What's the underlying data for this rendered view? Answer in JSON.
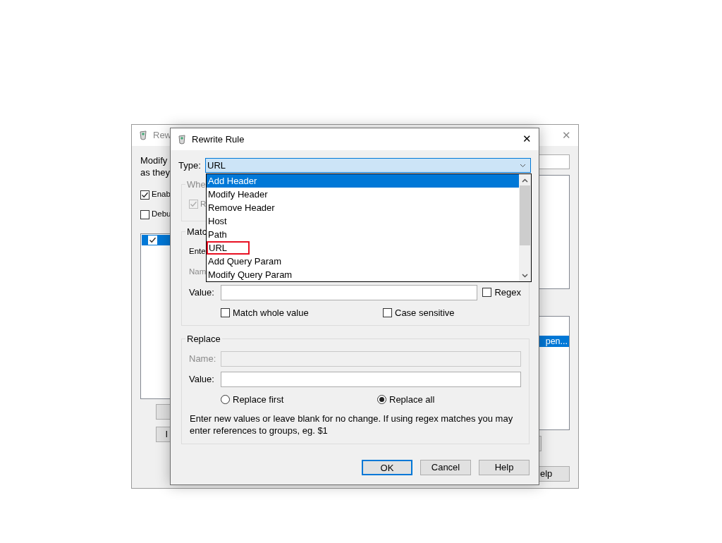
{
  "back_window": {
    "title": "Rew",
    "close_glyph": "✕",
    "description_lines": [
      "Modify",
      "as they"
    ],
    "options": [
      {
        "label": "Enab",
        "checked": true
      },
      {
        "label": "Debu",
        "checked": false
      }
    ],
    "rules_list": [
      {
        "checked": true,
        "selected": true
      }
    ],
    "left_button": "I",
    "right_list": [
      {
        "text": "pen...",
        "selected": true
      }
    ],
    "partial_button": "elp"
  },
  "dialog": {
    "title": "Rewrite Rule",
    "close_glyph": "✕",
    "type_label": "Type:",
    "type_value": "URL",
    "dropdown": [
      {
        "label": "Add Header",
        "selected": true,
        "highlighted": false
      },
      {
        "label": "Modify Header",
        "selected": false,
        "highlighted": false
      },
      {
        "label": "Remove Header",
        "selected": false,
        "highlighted": false
      },
      {
        "label": "Host",
        "selected": false,
        "highlighted": false
      },
      {
        "label": "Path",
        "selected": false,
        "highlighted": false
      },
      {
        "label": "URL",
        "selected": false,
        "highlighted": true
      },
      {
        "label": "Add Query Param",
        "selected": false,
        "highlighted": false
      },
      {
        "label": "Modify Query Param",
        "selected": false,
        "highlighted": false
      }
    ],
    "when_group": {
      "legend": "Whe",
      "checkbox": {
        "label": "R",
        "checked": true,
        "disabled": true
      }
    },
    "match_group": {
      "legend": "Matc",
      "hint": "Ente",
      "name_label": "Nam",
      "value_label": "Value:",
      "regex": {
        "label": "Regex",
        "checked": false
      },
      "match_whole": {
        "label": "Match whole value",
        "checked": false
      },
      "case_sensitive": {
        "label": "Case sensitive",
        "checked": false
      }
    },
    "replace_group": {
      "legend": "Replace",
      "name_label": "Name:",
      "name_disabled": true,
      "value_label": "Value:",
      "modes": [
        {
          "label": "Replace first",
          "selected": false
        },
        {
          "label": "Replace all",
          "selected": true
        }
      ],
      "help_text": "Enter new values or leave blank for no change. If using regex matches you may enter references to groups, eg. $1"
    },
    "buttons": [
      {
        "label": "OK",
        "default": true
      },
      {
        "label": "Cancel",
        "default": false
      },
      {
        "label": "Help",
        "default": false
      }
    ]
  }
}
